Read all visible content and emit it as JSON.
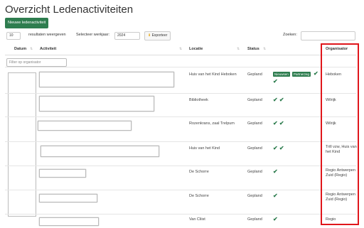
{
  "page": {
    "title": "Overzicht Ledenactiviteiten"
  },
  "toolbar": {
    "new_label": "Nieuwe ledenactiviteit",
    "length_value": "10",
    "length_label": "resultaten weergeven",
    "year_label": "Selecteer werkjaar:",
    "year_value": "2024",
    "export_label": "Exporteer",
    "search_label": "Zoeken:"
  },
  "table": {
    "headers": {
      "datum": "Datum",
      "activiteit": "Activiteit",
      "locatie": "Locatie",
      "status": "Status",
      "organisator": "Organisator"
    },
    "filter_placeholder": "Filter op organisator",
    "rows": [
      {
        "locatie": "Huis van het Kind Heboken",
        "status": "Gepland",
        "organisator": "Heboken",
        "badges": [
          "Nieuwsen",
          "Partnerzeg"
        ],
        "checks": "✔ ✔"
      },
      {
        "locatie": "Bibliotheek",
        "status": "Gepland",
        "organisator": "Wilrijk",
        "checks": "✔ ✔"
      },
      {
        "locatie": "Rozenkrans, zaal Trelpum",
        "status": "Gepland",
        "organisator": "Wilrijk",
        "checks": "✔ ✔"
      },
      {
        "locatie": "Huis van het Kind",
        "status": "Gepland",
        "organisator": "Trill vzw, Huis van het Kind",
        "checks": "✔ ✔"
      },
      {
        "locatie": "De Schorre",
        "status": "Gepland",
        "organisator": "Regio Antwerpen Zuid (Regio)",
        "checks": "✔"
      },
      {
        "locatie": "De Schorre",
        "status": "Gepland",
        "organisator": "Regio Antwerpen Zuid (Regio)",
        "checks": "✔"
      },
      {
        "locatie": "Van Cliist",
        "status": "Gepland",
        "organisator": "Regio",
        "checks": "✔"
      }
    ]
  },
  "colors": {
    "accent": "#2e7d4f",
    "highlight": "#e0161b"
  }
}
